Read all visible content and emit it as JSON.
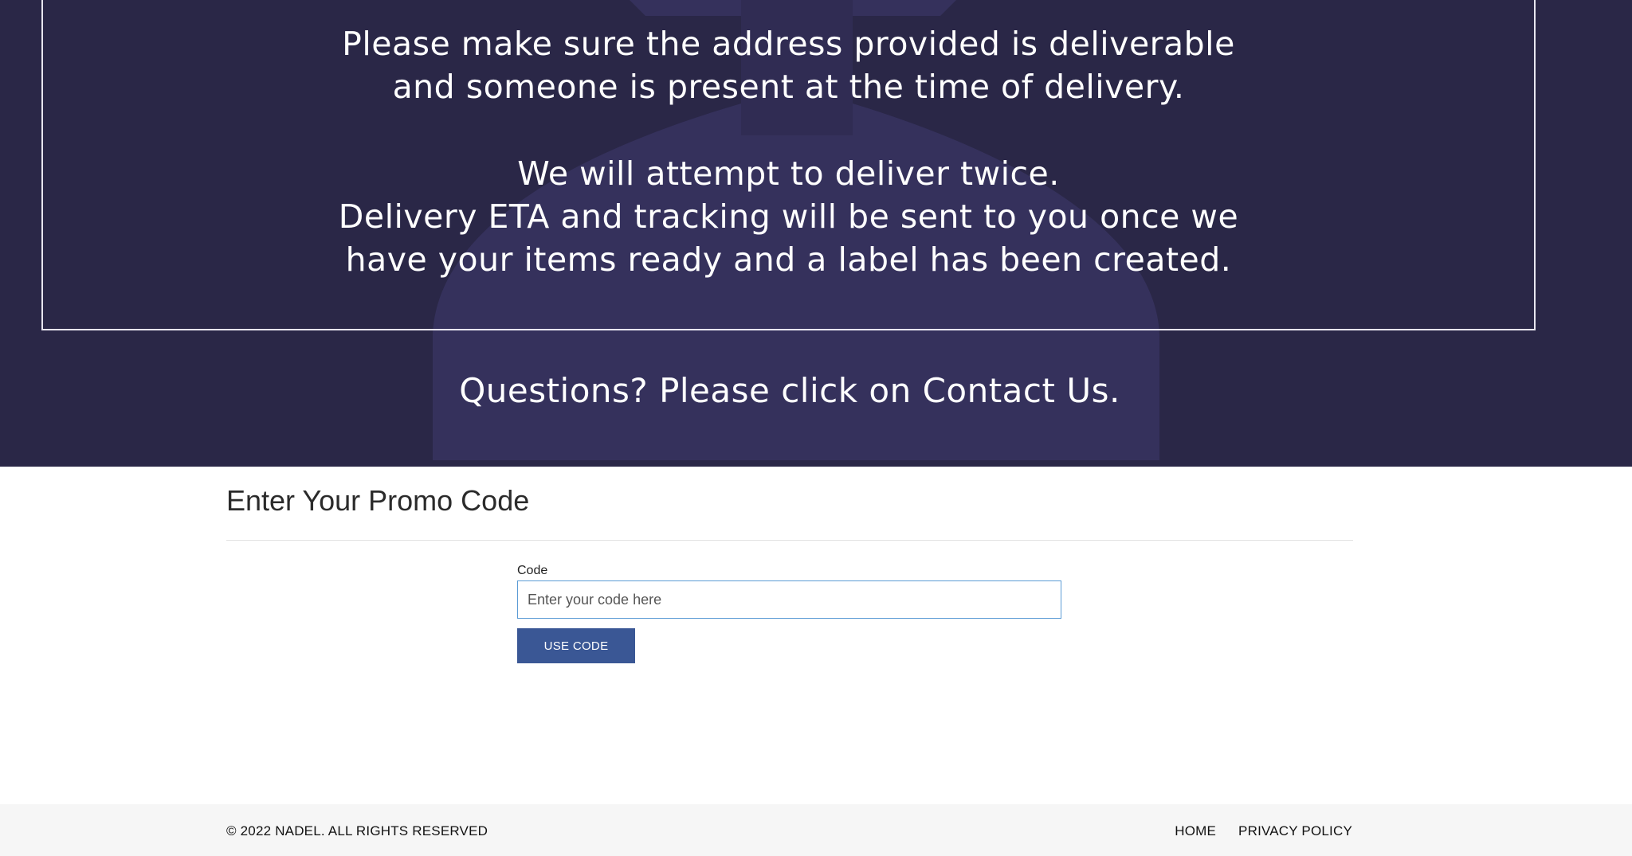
{
  "hero": {
    "background_color": "#2a2747",
    "notice_lines": [
      "Please make sure the address provided is deliverable",
      "and someone is present at the time of delivery.",
      "We will attempt to deliver twice.",
      "Delivery ETA and tracking will be sent to you once we",
      "have your items ready and a label has been created."
    ],
    "questions": "Questions? Please click on Contact Us.",
    "watermark_icon": "figure-silhouette-icon"
  },
  "promo": {
    "title": "Enter Your Promo Code",
    "code_label": "Code",
    "code_placeholder": "Enter your code here",
    "code_value": "",
    "button_label": "USE CODE",
    "button_color": "#3a5795"
  },
  "footer": {
    "copyright": "© 2022 NADEL. ALL RIGHTS RESERVED",
    "links": [
      "HOME",
      "PRIVACY POLICY"
    ]
  }
}
